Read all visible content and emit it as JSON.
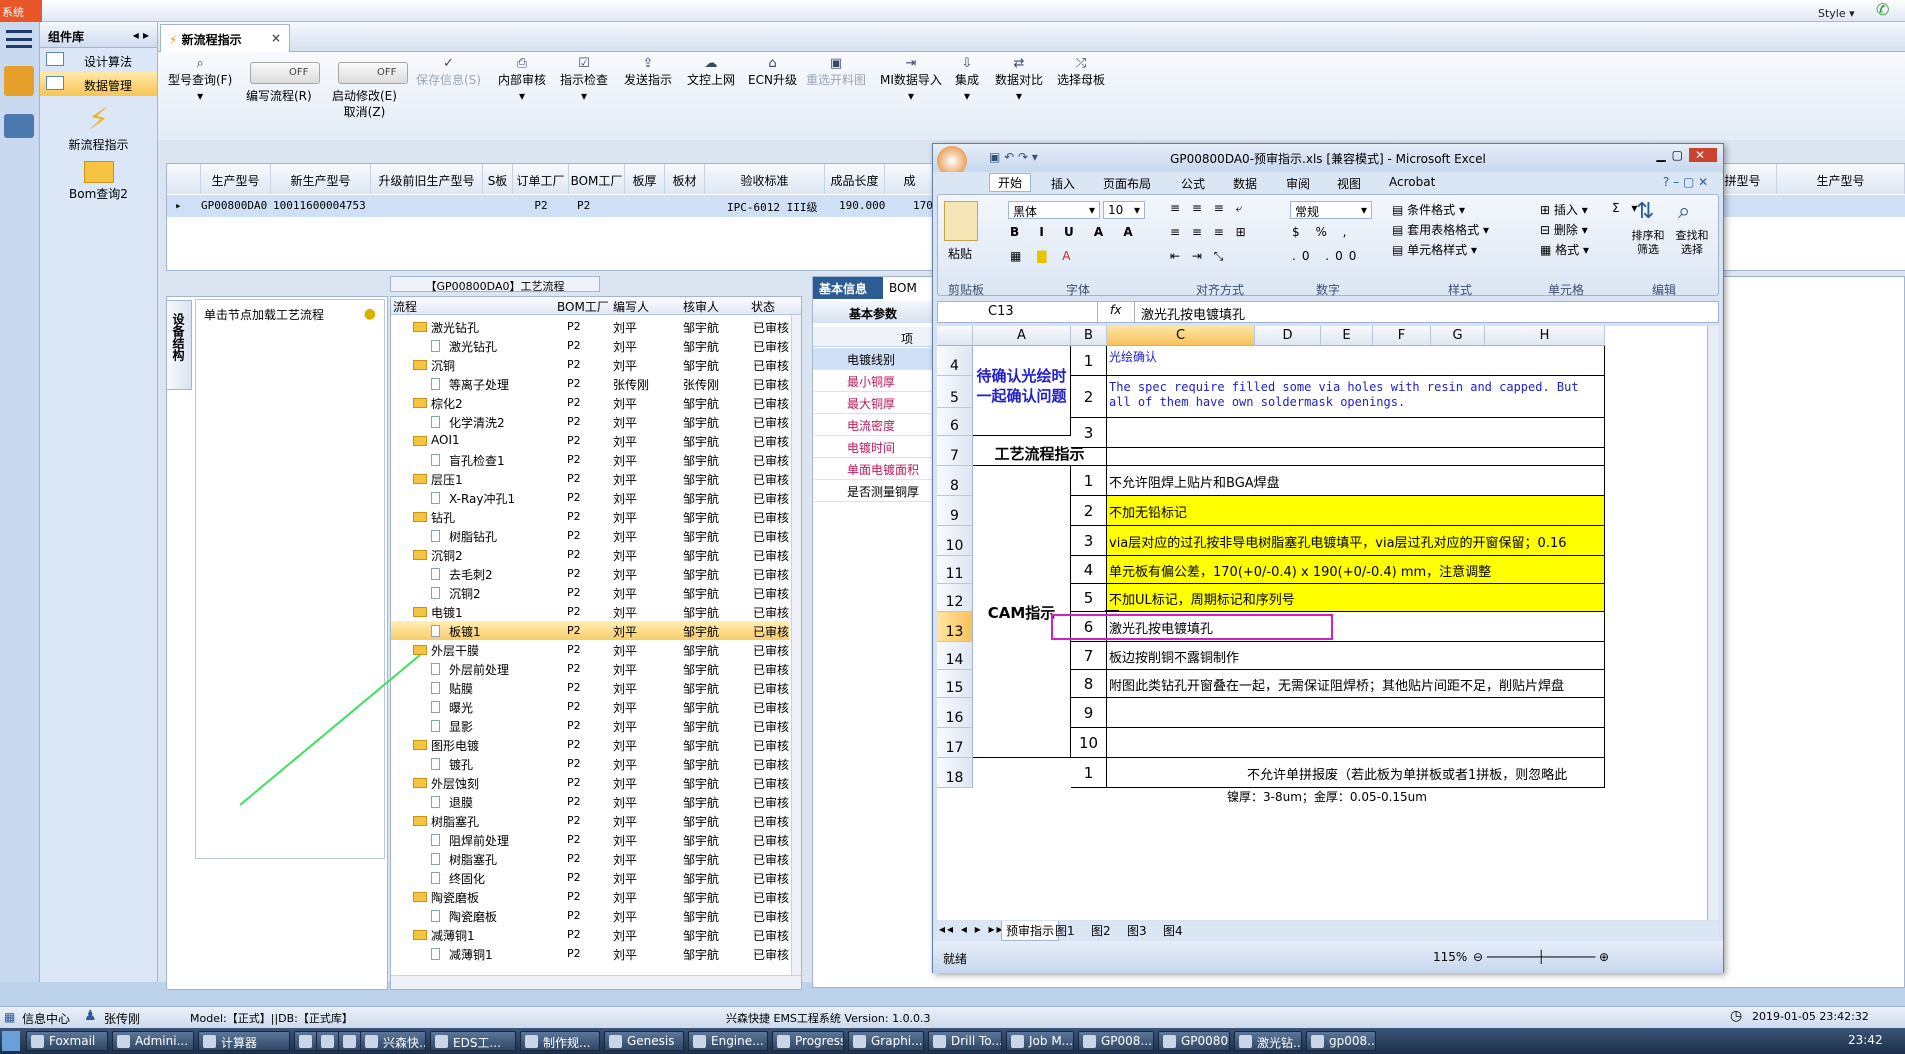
{
  "app": {
    "menu_label": "系统",
    "style_label": "Style"
  },
  "sidebar": {
    "header": "组件库",
    "items": [
      {
        "label": "设计算法"
      },
      {
        "label": "数据管理"
      }
    ],
    "big_items": [
      {
        "label": "新流程指示"
      },
      {
        "label": "Bom查询2"
      }
    ]
  },
  "doc_tab": {
    "label": "新流程指示"
  },
  "toolbar": {
    "buttons": [
      {
        "label": "型号查询(F)"
      },
      {
        "label": "编写流程(R)"
      },
      {
        "label": "启动修改(E)"
      },
      {
        "label": "保存信息(S)"
      },
      {
        "label": "内部审核"
      },
      {
        "label": "指示检查"
      },
      {
        "label": "发送指示"
      },
      {
        "label": "文控上网"
      },
      {
        "label": "ECN升级"
      },
      {
        "label": "重选开料图"
      },
      {
        "label": "MI数据导入"
      },
      {
        "label": "集成"
      },
      {
        "label": "数据对比"
      },
      {
        "label": "选择母板"
      }
    ],
    "cancel_label": "取消(Z)",
    "toggle_off": "OFF"
  },
  "grid": {
    "headers": [
      "生产型号",
      "新生产型号",
      "升级前旧生产型号",
      "S板",
      "订单工厂",
      "BOM工厂",
      "板厚",
      "板材",
      "验收标准",
      "成品长度",
      "成"
    ],
    "row": [
      "GP00800DA0",
      "10011600004753",
      "",
      "",
      "P2",
      "P2",
      "",
      "",
      "IPC-6012 III级",
      "190.000",
      "170"
    ],
    "right_headers": [
      "合拼型号",
      "生产型号"
    ]
  },
  "left_panel": {
    "vertical_tab": "设备结构",
    "hint": "单击节点加载工艺流程"
  },
  "flow": {
    "title": "【GP00800DA0】工艺流程",
    "headers": [
      "流程",
      "BOM工厂",
      "编写人",
      "核审人",
      "状态"
    ],
    "rows": [
      {
        "name": "激光钻孔",
        "level": 1,
        "bom": "P2",
        "writer": "刘平",
        "reviewer": "邹宇航",
        "status": "已审核"
      },
      {
        "name": "激光钻孔",
        "level": 2,
        "bom": "P2",
        "writer": "刘平",
        "reviewer": "邹宇航",
        "status": "已审核"
      },
      {
        "name": "沉铜",
        "level": 1,
        "bom": "P2",
        "writer": "刘平",
        "reviewer": "邹宇航",
        "status": "已审核"
      },
      {
        "name": "等离子处理",
        "level": 2,
        "bom": "P2",
        "writer": "张传刚",
        "reviewer": "张传刚",
        "status": "已审核"
      },
      {
        "name": "棕化2",
        "level": 1,
        "bom": "P2",
        "writer": "刘平",
        "reviewer": "邹宇航",
        "status": "已审核"
      },
      {
        "name": "化学清洗2",
        "level": 2,
        "bom": "P2",
        "writer": "刘平",
        "reviewer": "邹宇航",
        "status": "已审核"
      },
      {
        "name": "AOI1",
        "level": 1,
        "bom": "P2",
        "writer": "刘平",
        "reviewer": "邹宇航",
        "status": "已审核"
      },
      {
        "name": "盲孔检查1",
        "level": 2,
        "bom": "P2",
        "writer": "刘平",
        "reviewer": "邹宇航",
        "status": "已审核"
      },
      {
        "name": "层压1",
        "level": 1,
        "bom": "P2",
        "writer": "刘平",
        "reviewer": "邹宇航",
        "status": "已审核"
      },
      {
        "name": "X-Ray冲孔1",
        "level": 2,
        "bom": "P2",
        "writer": "刘平",
        "reviewer": "邹宇航",
        "status": "已审核"
      },
      {
        "name": "钻孔",
        "level": 1,
        "bom": "P2",
        "writer": "刘平",
        "reviewer": "邹宇航",
        "status": "已审核"
      },
      {
        "name": "树脂钻孔",
        "level": 2,
        "bom": "P2",
        "writer": "刘平",
        "reviewer": "邹宇航",
        "status": "已审核"
      },
      {
        "name": "沉铜2",
        "level": 1,
        "bom": "P2",
        "writer": "刘平",
        "reviewer": "邹宇航",
        "status": "已审核"
      },
      {
        "name": "去毛刺2",
        "level": 2,
        "bom": "P2",
        "writer": "刘平",
        "reviewer": "邹宇航",
        "status": "已审核"
      },
      {
        "name": "沉铜2",
        "level": 2,
        "bom": "P2",
        "writer": "刘平",
        "reviewer": "邹宇航",
        "status": "已审核"
      },
      {
        "name": "电镀1",
        "level": 1,
        "bom": "P2",
        "writer": "刘平",
        "reviewer": "邹宇航",
        "status": "已审核"
      },
      {
        "name": "板镀1",
        "level": 2,
        "bom": "P2",
        "writer": "刘平",
        "reviewer": "邹宇航",
        "status": "已审核",
        "selected": true
      },
      {
        "name": "外层干膜",
        "level": 1,
        "bom": "P2",
        "writer": "刘平",
        "reviewer": "邹宇航",
        "status": "已审核"
      },
      {
        "name": "外层前处理",
        "level": 2,
        "bom": "P2",
        "writer": "刘平",
        "reviewer": "邹宇航",
        "status": "已审核"
      },
      {
        "name": "贴膜",
        "level": 2,
        "bom": "P2",
        "writer": "刘平",
        "reviewer": "邹宇航",
        "status": "已审核"
      },
      {
        "name": "曝光",
        "level": 2,
        "bom": "P2",
        "writer": "刘平",
        "reviewer": "邹宇航",
        "status": "已审核"
      },
      {
        "name": "显影",
        "level": 2,
        "bom": "P2",
        "writer": "刘平",
        "reviewer": "邹宇航",
        "status": "已审核"
      },
      {
        "name": "图形电镀",
        "level": 1,
        "bom": "P2",
        "writer": "刘平",
        "reviewer": "邹宇航",
        "status": "已审核"
      },
      {
        "name": "镀孔",
        "level": 2,
        "bom": "P2",
        "writer": "刘平",
        "reviewer": "邹宇航",
        "status": "已审核"
      },
      {
        "name": "外层蚀刻",
        "level": 1,
        "bom": "P2",
        "writer": "刘平",
        "reviewer": "邹宇航",
        "status": "已审核"
      },
      {
        "name": "退膜",
        "level": 2,
        "bom": "P2",
        "writer": "刘平",
        "reviewer": "邹宇航",
        "status": "已审核"
      },
      {
        "name": "树脂塞孔",
        "level": 1,
        "bom": "P2",
        "writer": "刘平",
        "reviewer": "邹宇航",
        "status": "已审核"
      },
      {
        "name": "阻焊前处理",
        "level": 2,
        "bom": "P2",
        "writer": "刘平",
        "reviewer": "邹宇航",
        "status": "已审核"
      },
      {
        "name": "树脂塞孔",
        "level": 2,
        "bom": "P2",
        "writer": "刘平",
        "reviewer": "邹宇航",
        "status": "已审核"
      },
      {
        "name": "终固化",
        "level": 2,
        "bom": "P2",
        "writer": "刘平",
        "reviewer": "邹宇航",
        "status": "已审核"
      },
      {
        "name": "陶瓷磨板",
        "level": 1,
        "bom": "P2",
        "writer": "刘平",
        "reviewer": "邹宇航",
        "status": "已审核"
      },
      {
        "name": "陶瓷磨板",
        "level": 2,
        "bom": "P2",
        "writer": "刘平",
        "reviewer": "邹宇航",
        "status": "已审核"
      },
      {
        "name": "减薄铜1",
        "level": 1,
        "bom": "P2",
        "writer": "刘平",
        "reviewer": "邹宇航",
        "status": "已审核"
      },
      {
        "name": "减薄铜1",
        "level": 2,
        "bom": "P2",
        "writer": "刘平",
        "reviewer": "邹宇航",
        "status": "已审核"
      }
    ]
  },
  "right_panel": {
    "tabs": [
      "基本信息",
      "BOM"
    ],
    "subtab": "基本参数",
    "col_header": "项目",
    "params": [
      "电镀线别",
      "最小铜厚",
      "最大铜厚",
      "电流密度",
      "电镀时间",
      "单面电镀面积",
      "是否测量铜厚"
    ]
  },
  "excel": {
    "title": "GP00800DA0-预审指示.xls  [兼容模式] - Microsoft Excel",
    "tabs": [
      "开始",
      "插入",
      "页面布局",
      "公式",
      "数据",
      "审阅",
      "视图",
      "Acrobat"
    ],
    "font_name": "黑体",
    "font_size": "10",
    "number_format": "常规",
    "ribbon_groups": [
      "剪贴板",
      "字体",
      "对齐方式",
      "数字",
      "样式",
      "单元格",
      "编辑"
    ],
    "ribbon_labels": {
      "paste": "粘贴",
      "cond_format": "条件格式",
      "table_format": "套用表格格式",
      "cell_style": "单元格样式",
      "insert": "插入",
      "delete": "删除",
      "format": "格式",
      "sort": "排序和筛选",
      "find": "查找和选择"
    },
    "name_box": "C13",
    "formula": "激光孔按电镀填孔",
    "columns": [
      "A",
      "B",
      "C",
      "D",
      "E",
      "F",
      "G",
      "H"
    ],
    "rows": [
      "4",
      "5",
      "6",
      "7",
      "8",
      "9",
      "10",
      "11",
      "12",
      "13",
      "14",
      "15",
      "16",
      "17",
      "18"
    ],
    "block_top_label": "待确认光绘时一起确认问题",
    "block_top_items": [
      {
        "no": "1",
        "text": "光绘确认"
      },
      {
        "no": "2",
        "text": "The spec require filled some via holes with resin and capped. But all of them have own soldermask openings."
      },
      {
        "no": "3",
        "text": ""
      }
    ],
    "section_label": "工艺流程指示",
    "cam_label": "CAM指示",
    "cam_items": [
      {
        "no": "1",
        "text": "不允许阻焊上贴片和BGA焊盘"
      },
      {
        "no": "2",
        "text": "不加无铅标记"
      },
      {
        "no": "3",
        "text": "via层对应的过孔按非导电树脂塞孔电镀填平，via层过孔对应的开窗保留；0.16"
      },
      {
        "no": "4",
        "text": "单元板有偏公差，170(+0/-0.4) x 190(+0/-0.4) mm，注意调整"
      },
      {
        "no": "5",
        "text": "不加UL标记，周期标记和序列号"
      },
      {
        "no": "6",
        "text": "激光孔按电镀填孔"
      },
      {
        "no": "7",
        "text": "板边按削铜不露铜制作"
      },
      {
        "no": "8",
        "text": "附图此类钻孔开窗叠在一起，无需保证阻焊桥；其他贴片间距不足，削贴片焊盘"
      },
      {
        "no": "9",
        "text": ""
      },
      {
        "no": "10",
        "text": ""
      }
    ],
    "row18": {
      "no": "1",
      "text": "不允许单拼报废（若此板为单拼板或者1拼板，则忽略此"
    },
    "row19_text": "镍厚：3-8um；金厚：0.05-0.15um",
    "sheet_tabs": [
      "预审指示",
      "图1",
      "图2",
      "图3",
      "图4"
    ],
    "status": "就绪",
    "zoom": "115%"
  },
  "statusbar": {
    "info_center": "信息中心",
    "user": "张传刚",
    "model": "Model:【正式】||DB:【正式库】",
    "company": "兴森快捷 EMS工程系统 Version: 1.0.0.3",
    "datetime": "2019-01-05 23:42:32"
  },
  "taskbar": {
    "items": [
      "Foxmail",
      "Admini...",
      "计算器",
      "",
      "",
      "",
      "兴森快...",
      "EDS工...",
      "制作规...",
      "Genesis",
      "Engine...",
      "Progress",
      "Graphi...",
      "Drill To...",
      "Job M...",
      "GP008...",
      "GP0080...",
      "激光钻...",
      "gp008..."
    ],
    "clock": "23:42"
  }
}
